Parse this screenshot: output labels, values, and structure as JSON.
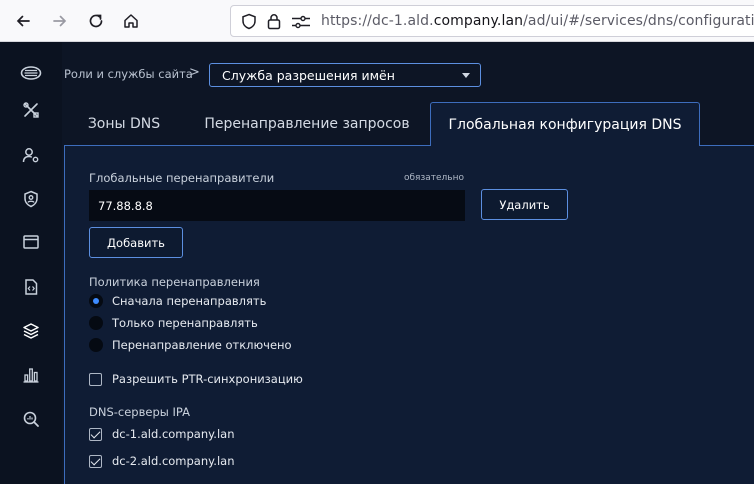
{
  "browser": {
    "url_prefix": "https://dc-1.ald.",
    "url_domain": "company.lan",
    "url_suffix": "/ad/ui/#/services/dns/configuration"
  },
  "sidebar": {
    "items": [
      {
        "name": "logo-icon"
      },
      {
        "name": "tools-icon"
      },
      {
        "name": "user-settings-icon"
      },
      {
        "name": "shield-user-icon"
      },
      {
        "name": "window-icon"
      },
      {
        "name": "code-file-icon"
      },
      {
        "name": "layers-icon"
      },
      {
        "name": "bar-chart-icon"
      },
      {
        "name": "search-chart-icon"
      }
    ]
  },
  "breadcrumb": {
    "root": "Роли и службы сайта",
    "separator": ">",
    "selected_service": "Служба разрешения имён"
  },
  "tabs": [
    {
      "label": "Зоны DNS",
      "active": false
    },
    {
      "label": "Перенаправление запросов",
      "active": false
    },
    {
      "label": "Глобальная конфигурация DNS",
      "active": true
    }
  ],
  "form": {
    "forwarders_label": "Глобальные перенаправители",
    "required_note": "обязательно",
    "forwarder_value": "77.88.8.8",
    "delete_label": "Удалить",
    "add_label": "Добавить",
    "policy_label": "Политика перенаправления",
    "policy_options": [
      {
        "label": "Сначала перенаправлять",
        "checked": true
      },
      {
        "label": "Только перенаправлять",
        "checked": false
      },
      {
        "label": "Перенаправление отключено",
        "checked": false
      }
    ],
    "ptr_sync_label": "Разрешить PTR-синхронизацию",
    "ptr_sync_checked": false,
    "dns_servers_label": "DNS-серверы IPA",
    "dns_servers": [
      {
        "label": "dc-1.ald.company.lan",
        "checked": true
      },
      {
        "label": "dc-2.ald.company.lan",
        "checked": true
      }
    ]
  },
  "colors": {
    "accent": "#3d8bff",
    "border": "#5c8fe0",
    "panel": "#0f1c34",
    "background": "#0d1525"
  }
}
